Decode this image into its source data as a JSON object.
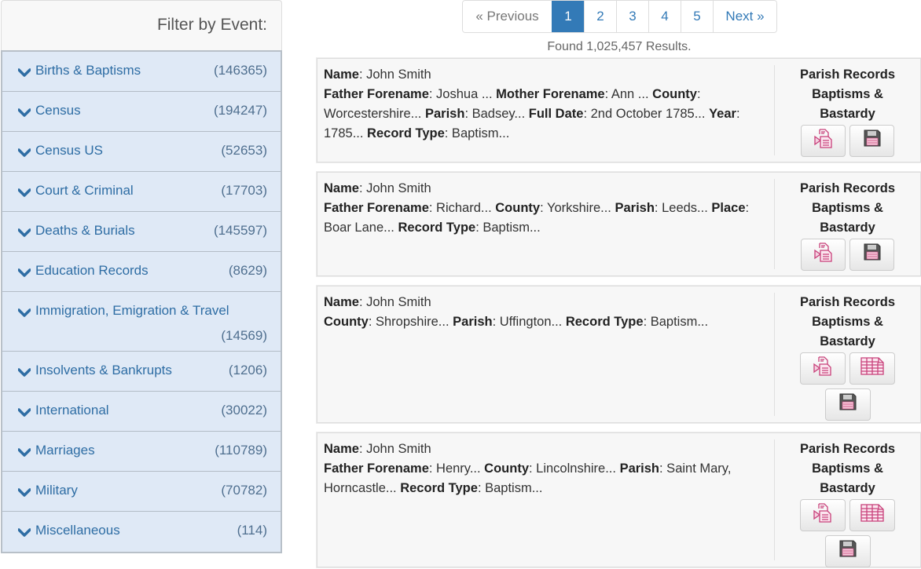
{
  "sidebar": {
    "title": "Filter by Event:",
    "items": [
      {
        "label": "Births & Baptisms",
        "count": "(146365)"
      },
      {
        "label": "Census",
        "count": "(194247)"
      },
      {
        "label": "Census US",
        "count": "(52653)"
      },
      {
        "label": "Court & Criminal",
        "count": "(17703)"
      },
      {
        "label": "Deaths & Burials",
        "count": "(145597)"
      },
      {
        "label": "Education Records",
        "count": "(8629)"
      },
      {
        "label": "Immigration, Emigration & Travel",
        "count": "(14569)"
      },
      {
        "label": "Insolvents & Bankrupts",
        "count": "(1206)"
      },
      {
        "label": "International",
        "count": "(30022)"
      },
      {
        "label": "Marriages",
        "count": "(110789)"
      },
      {
        "label": "Military",
        "count": "(70782)"
      },
      {
        "label": "Miscellaneous",
        "count": "(114)"
      }
    ],
    "item_icon": "chevron-down-icon"
  },
  "pagination": {
    "previous": "« Previous",
    "pages": [
      "1",
      "2",
      "3",
      "4",
      "5"
    ],
    "active_page": "1",
    "next": "Next »"
  },
  "found_text": "Found 1,025,457 Results.",
  "colors": {
    "accent": "#337ab7",
    "filter_bg": "#dfe9f6",
    "icon_pink": "#c8407a"
  },
  "results": [
    {
      "fields": [
        [
          {
            "k": "Name",
            "v": ": John  Smith"
          }
        ],
        [
          {
            "k": "Father Forename",
            "v": ": Joshua ... "
          },
          {
            "k": "Mother Forename",
            "v": ": Ann ... "
          },
          {
            "k": "County",
            "v": ": Worcestershire... "
          },
          {
            "k": "Parish",
            "v": ": Badsey... "
          },
          {
            "k": "Full Date",
            "v": ": 2nd October 1785... "
          },
          {
            "k": "Year",
            "v": ": 1785... "
          },
          {
            "k": "Record Type",
            "v": ": Baptism..."
          }
        ]
      ],
      "source": [
        "Parish Records",
        "Baptisms &",
        "Bastardy"
      ],
      "buttons": [
        "transcript-icon",
        "save-icon"
      ]
    },
    {
      "fields": [
        [
          {
            "k": "Name",
            "v": ": John Smith"
          }
        ],
        [
          {
            "k": "Father Forename",
            "v": ": Richard... "
          },
          {
            "k": "County",
            "v": ": Yorkshire... "
          },
          {
            "k": "Parish",
            "v": ": Leeds... "
          },
          {
            "k": "Place",
            "v": ": Boar Lane... "
          },
          {
            "k": "Record Type",
            "v": ": Baptism..."
          }
        ]
      ],
      "source": [
        "Parish Records",
        "Baptisms &",
        "Bastardy"
      ],
      "buttons": [
        "transcript-icon",
        "save-icon"
      ]
    },
    {
      "fields": [
        [
          {
            "k": "Name",
            "v": ": John Smith"
          }
        ],
        [
          {
            "k": "County",
            "v": ": Shropshire... "
          },
          {
            "k": "Parish",
            "v": ": Uffington... "
          },
          {
            "k": "Record Type",
            "v": ": Baptism..."
          }
        ]
      ],
      "source": [
        "Parish Records",
        "Baptisms &",
        "Bastardy"
      ],
      "buttons": [
        "transcript-icon",
        "image-icon",
        "save-icon"
      ]
    },
    {
      "fields": [
        [
          {
            "k": "Name",
            "v": ": John Smith"
          }
        ],
        [
          {
            "k": "Father Forename",
            "v": ": Henry... "
          },
          {
            "k": "County",
            "v": ": Lincolnshire... "
          },
          {
            "k": "Parish",
            "v": ": Saint Mary, Horncastle... "
          },
          {
            "k": "Record Type",
            "v": ": Baptism..."
          }
        ]
      ],
      "source": [
        "Parish Records",
        "Baptisms &",
        "Bastardy"
      ],
      "buttons": [
        "transcript-icon",
        "image-icon",
        "save-icon"
      ]
    }
  ]
}
